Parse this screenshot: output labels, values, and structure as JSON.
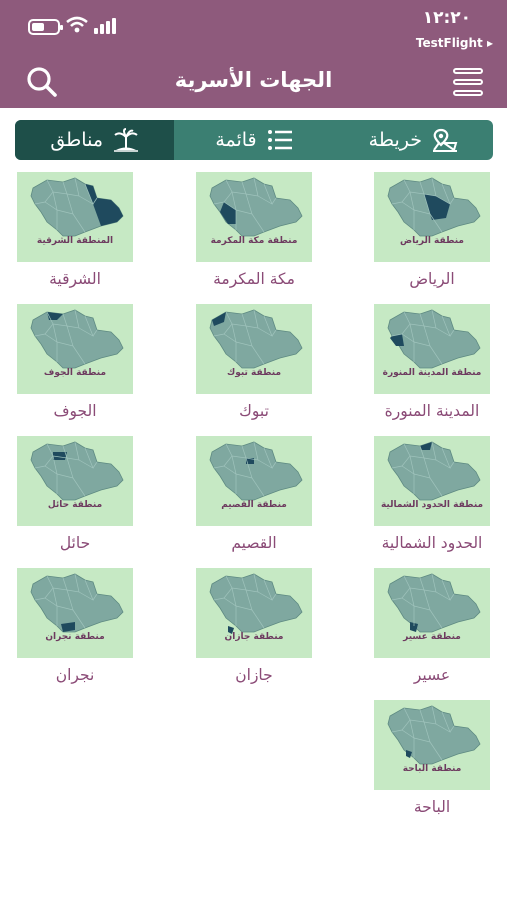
{
  "status_bar": {
    "time": "١٢:٢٠",
    "back_label": "TestFlight ▸"
  },
  "header": {
    "title": "الجهات الأسرية",
    "menu_icon": "hamburger-icon",
    "search_icon": "search-icon"
  },
  "segments": [
    {
      "label": "مناطق",
      "icon": "palm-island-icon",
      "active": true
    },
    {
      "label": "قائمة",
      "icon": "list-icon",
      "active": false
    },
    {
      "label": "خريطة",
      "icon": "map-pin-icon",
      "active": false
    }
  ],
  "regions": [
    {
      "caption": "منطقة الرياض",
      "name": "الرياض"
    },
    {
      "caption": "منطقة مكة المكرمة",
      "name": "مكة المكرمة"
    },
    {
      "caption": "المنطقة الشرقية",
      "name": "الشرقية"
    },
    {
      "caption": "منطقة المدينة المنورة",
      "name": "المدينة المنورة"
    },
    {
      "caption": "منطقة تبوك",
      "name": "تبوك"
    },
    {
      "caption": "منطقة الجوف",
      "name": "الجوف"
    },
    {
      "caption": "منطقة الحدود الشمالية",
      "name": "الحدود الشمالية"
    },
    {
      "caption": "منطقة القصيم",
      "name": "القصيم"
    },
    {
      "caption": "منطقة حائل",
      "name": "حائل"
    },
    {
      "caption": "منطقة عسير",
      "name": "عسير"
    },
    {
      "caption": "منطقة جازان",
      "name": "جازان"
    },
    {
      "caption": "منطقة نجران",
      "name": "نجران"
    },
    {
      "caption": "منطقة الباحة",
      "name": "الباحة"
    }
  ],
  "colors": {
    "header": "#8e5a7c",
    "segment_bg": "#3b7f72",
    "segment_active": "#1e4f49",
    "tile_bg": "#c6e9c4",
    "map_base": "#7fa8a0",
    "map_highlight": "#1f4a5e",
    "label": "#8a4a76"
  }
}
